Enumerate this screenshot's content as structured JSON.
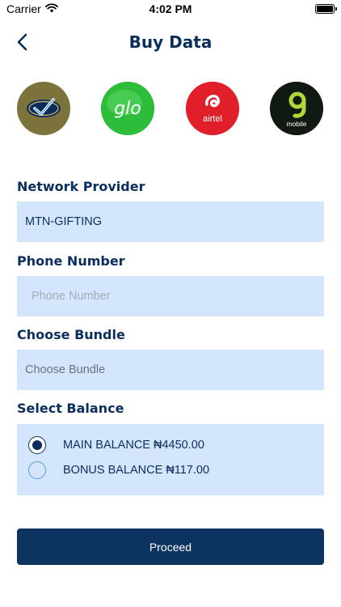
{
  "status_bar": {
    "carrier": "Carrier",
    "time": "4:02 PM",
    "wifi_icon": "wifi-icon",
    "battery_icon": "battery-icon"
  },
  "header": {
    "title": "Buy Data",
    "back_icon": "chevron-left-icon"
  },
  "networks": [
    {
      "id": "mtn",
      "logo_text": "MTN",
      "color": "#7c723c"
    },
    {
      "id": "glo",
      "logo_text": "glo",
      "color": "#2ebd3b"
    },
    {
      "id": "airtel",
      "logo_text": "airtel",
      "color": "#e11f2a"
    },
    {
      "id": "9mobile",
      "logo_text": "mobile",
      "color": "#101a12"
    }
  ],
  "form": {
    "network_provider_label": "Network Provider",
    "network_provider_value": "MTN-GIFTING",
    "phone_label": "Phone Number",
    "phone_placeholder": "Phone Number",
    "bundle_label": "Choose Bundle",
    "bundle_placeholder": "Choose Bundle",
    "balance_label": "Select Balance",
    "balances": [
      {
        "label": "MAIN BALANCE ₦4450.00",
        "selected": true
      },
      {
        "label": "BONUS BALANCE ₦117.00",
        "selected": false
      }
    ]
  },
  "actions": {
    "proceed_label": "Proceed"
  },
  "colors": {
    "primary": "#0b2e5c",
    "field_bg": "#d4e6fd",
    "button_bg": "#0d3360"
  }
}
